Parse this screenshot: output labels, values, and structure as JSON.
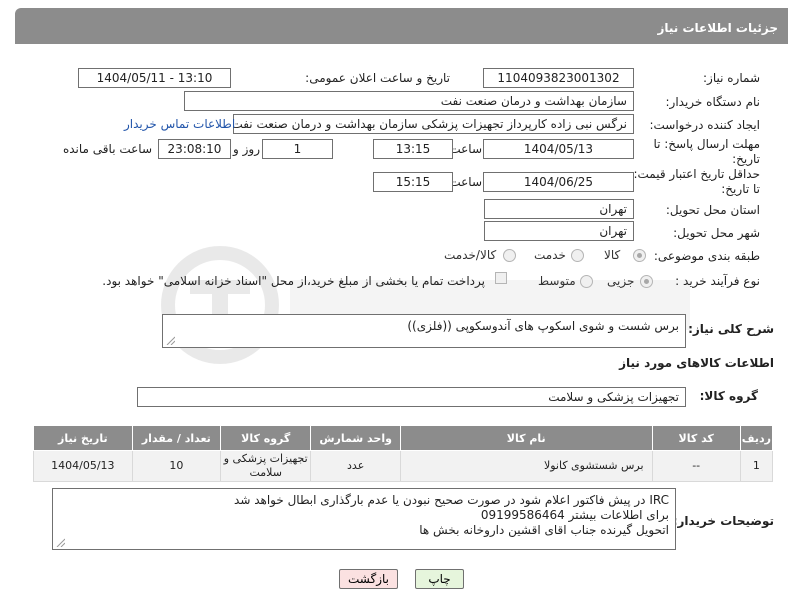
{
  "header": {
    "title": "جزئیات اطلاعات نیاز"
  },
  "fields": {
    "need_number_label": "شماره نیاز:",
    "need_number": "1104093823001302",
    "announce_label": "تاریخ و ساعت اعلان عمومی:",
    "announce_value": "1404/05/11 - 13:10",
    "buyer_org_label": "نام دستگاه خریدار:",
    "buyer_org": "سازمان بهداشت و درمان صنعت نفت",
    "creator_label": "ایجاد کننده درخواست:",
    "creator": "نرگس نبی زاده کارپرداز تجهیزات پزشکی سازمان بهداشت و درمان صنعت نفت",
    "contact_link": "اطلاعات تماس خریدار",
    "deadline_label_1": "مهلت ارسال پاسخ: تا",
    "deadline_label_2": "تاریخ:",
    "deadline_date": "1404/05/13",
    "time_label": "ساعت",
    "deadline_time": "13:15",
    "days_value": "1",
    "days_label": "روز و",
    "remaining_value": "23:08:10",
    "remaining_label": "ساعت باقی مانده",
    "price_label_1": "حداقل تاریخ اعتبار قیمت:",
    "price_label_2": "تا تاریخ:",
    "price_date": "1404/06/25",
    "price_time": "15:15",
    "province_label": "استان محل تحویل:",
    "province": "تهران",
    "city_label": "شهر محل تحویل:",
    "city": "تهران",
    "category_label": "طبقه بندی موضوعی:",
    "category_options": [
      "کالا",
      "خدمت",
      "کالا/خدمت"
    ],
    "process_label": "نوع فرآیند خرید :",
    "process_options": [
      "جزیی",
      "متوسط"
    ],
    "payment_note": "پرداخت تمام یا بخشی از مبلغ خرید،از محل \"اسناد خزانه اسلامی\" خواهد بود."
  },
  "description": {
    "label": "شرح کلی نیاز:",
    "text": "برس شست و شوی اسکوپ های آندوسکوپی ((فلزی))"
  },
  "goods": {
    "section_title": "اطلاعات کالاهای مورد نیاز",
    "group_label": "گروه کالا:",
    "group_value": "تجهیزات پزشکی و سلامت"
  },
  "table": {
    "headers": [
      "ردیف",
      "کد کالا",
      "نام کالا",
      "واحد شمارش",
      "گروه کالا",
      "تعداد / مقدار",
      "تاریخ نیاز"
    ],
    "rows": [
      [
        "1",
        "--",
        "برس شستشوی کانولا",
        "عدد",
        "تجهیزات پزشکی و سلامت",
        "10",
        "1404/05/13"
      ]
    ]
  },
  "buyer_notes": {
    "label": "توضیحات خریدار:",
    "lines": [
      "IRC در پیش فاکتور اعلام شود در صورت صحیح نبودن یا عدم بارگذاری ابطال خواهد شد",
      "برای اطلاعات بیشتر 09199586464",
      "اتحویل گیرنده جناب اقای اقشین داروخانه بخش ها"
    ]
  },
  "buttons": {
    "print": "چاپ",
    "back": "بازگشت"
  },
  "colors": {
    "header_bg": "#8c8c8c",
    "link": "#2255aa",
    "print_bg": "#e6f5dc",
    "back_bg": "#fbe1e1"
  }
}
